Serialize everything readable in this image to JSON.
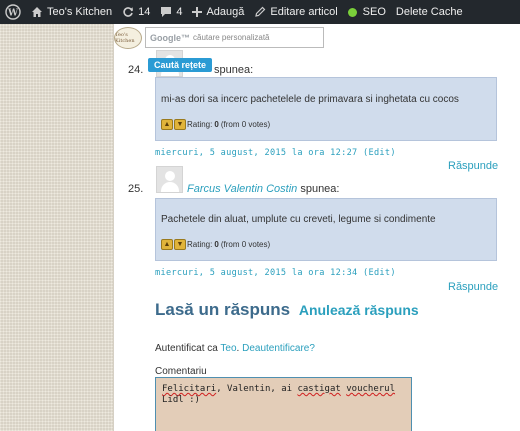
{
  "admin_bar": {
    "site_name": "Teo's Kitchen",
    "updates_count": "14",
    "comments_count": "4",
    "add_label": "Adaugă",
    "edit_label": "Editare articol",
    "seo_label": "SEO",
    "delete_cache_label": "Delete Cache",
    "seo_status_color": "#7ad03a"
  },
  "search": {
    "logo_text": "Teo's Kitchen",
    "google_label": "Google™",
    "placeholder": "căutare personalizată",
    "button_label": "Caută rețete"
  },
  "comments": [
    {
      "number": "24.",
      "author": "",
      "says": "spunea:",
      "text": "mi-as dori sa incerc pachetelele de primavara si inghetata cu cocos",
      "rating_label": "Rating:",
      "rating_value": "0",
      "rating_votes": "(from 0 votes)",
      "date": "miercuri, 5 august, 2015 la ora 12:27 (Edit)",
      "reply": "Răspunde"
    },
    {
      "number": "25.",
      "author": "Farcus Valentin Costin",
      "says": "spunea:",
      "text": "Pachetele din aluat, umplute cu creveti, legume si condimente",
      "rating_label": "Rating:",
      "rating_value": "0",
      "rating_votes": "(from 0 votes)",
      "date": "miercuri, 5 august, 2015 la ora 12:34 (Edit)",
      "reply": "Răspunde"
    }
  ],
  "reply_form": {
    "title": "Lasă un răspuns",
    "cancel_label": "Anulează răspuns",
    "logged_in_prefix": "Autentificat ca",
    "user": "Teo",
    "logout": "Deautentificare?",
    "comment_label": "Comentariu",
    "comment_line1_a": "Felicitari",
    "comment_line1_b": ", Valentin, ai ",
    "comment_line1_c": "castigat",
    "comment_line1_d": " ",
    "comment_line1_e": "voucherul",
    "comment_line2": "Lidl :)"
  }
}
